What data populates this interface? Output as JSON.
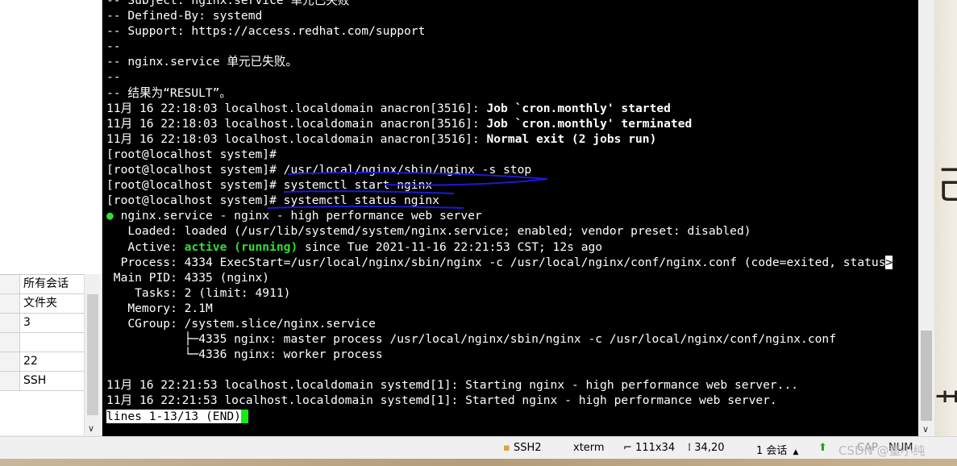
{
  "left_panel": {
    "properties": [
      "所有会话",
      "文件夹",
      "3",
      "",
      "22",
      "SSH"
    ]
  },
  "terminal": {
    "lines": [
      {
        "segments": [
          {
            "t": "-- Subject: nginx.service 单元已失败"
          }
        ]
      },
      {
        "segments": [
          {
            "t": "-- Defined-By: systemd"
          }
        ]
      },
      {
        "segments": [
          {
            "t": "-- Support: https://access.redhat.com/support"
          }
        ]
      },
      {
        "segments": [
          {
            "t": "--"
          }
        ]
      },
      {
        "segments": [
          {
            "t": "-- nginx.service 单元已失败。"
          }
        ]
      },
      {
        "segments": [
          {
            "t": "--"
          }
        ]
      },
      {
        "segments": [
          {
            "t": "-- 结果为“RESULT”。"
          }
        ]
      },
      {
        "segments": [
          {
            "t": "11月 16 22:18:03 localhost.localdomain anacron[3516]: "
          },
          {
            "t": "Job `cron.monthly' started",
            "s": "b"
          }
        ]
      },
      {
        "segments": [
          {
            "t": "11月 16 22:18:03 localhost.localdomain anacron[3516]: "
          },
          {
            "t": "Job `cron.monthly' terminated",
            "s": "b"
          }
        ]
      },
      {
        "segments": [
          {
            "t": "11月 16 22:18:03 localhost.localdomain anacron[3516]: "
          },
          {
            "t": "Normal exit (2 jobs run)",
            "s": "b"
          }
        ]
      },
      {
        "segments": [
          {
            "t": "[root@localhost system]#"
          }
        ]
      },
      {
        "segments": [
          {
            "t": "[root@localhost system]# /usr/local/nginx/sbin/nginx -s stop"
          }
        ]
      },
      {
        "segments": [
          {
            "t": "[root@localhost system]# systemctl start nginx"
          }
        ]
      },
      {
        "segments": [
          {
            "t": "[root@localhost system]# systemctl status nginx"
          }
        ]
      },
      {
        "segments": [
          {
            "t": "●",
            "s": "gd"
          },
          {
            "t": " nginx.service - nginx - high performance web server"
          }
        ]
      },
      {
        "segments": [
          {
            "t": "   Loaded: loaded (/usr/lib/systemd/system/nginx.service; enabled; vendor preset: disabled)"
          }
        ]
      },
      {
        "segments": [
          {
            "t": "   Active: "
          },
          {
            "t": "active (running)",
            "s": "g"
          },
          {
            "t": " since Tue 2021-11-16 22:21:53 CST; 12s ago"
          }
        ]
      },
      {
        "segments": [
          {
            "t": "  Process: 4334 ExecStart=/usr/local/nginx/sbin/nginx -c /usr/local/nginx/conf/nginx.conf (code=exited, status"
          },
          {
            "t": ">",
            "s": "cut"
          }
        ]
      },
      {
        "segments": [
          {
            "t": " Main PID: 4335 (nginx)"
          }
        ]
      },
      {
        "segments": [
          {
            "t": "    Tasks: 2 (limit: 4911)"
          }
        ]
      },
      {
        "segments": [
          {
            "t": "   Memory: 2.1M"
          }
        ]
      },
      {
        "segments": [
          {
            "t": "   CGroup: /system.slice/nginx.service"
          }
        ]
      },
      {
        "segments": [
          {
            "t": "           ├─4335 nginx: master process /usr/local/nginx/sbin/nginx -c /usr/local/nginx/conf/nginx.conf"
          }
        ]
      },
      {
        "segments": [
          {
            "t": "           └─4336 nginx: worker process"
          }
        ]
      },
      {
        "segments": [
          {
            "t": ""
          }
        ]
      },
      {
        "segments": [
          {
            "t": "11月 16 22:21:53 localhost.localdomain systemd[1]: Starting nginx - high performance web server..."
          }
        ]
      },
      {
        "segments": [
          {
            "t": "11月 16 22:21:53 localhost.localdomain systemd[1]: Started nginx - high performance web server."
          }
        ]
      },
      {
        "segments": [
          {
            "t": "lines 1-13/13 (END)",
            "s": "pager"
          },
          {
            "t": "",
            "s": "cursor"
          }
        ]
      }
    ]
  },
  "status_bar": {
    "protocol": "SSH2",
    "terminal_type": "xterm",
    "size": "111x34",
    "cursor_pos": "34,20",
    "sessions": "1 会话",
    "caps": "CAP",
    "num": "NUM"
  },
  "watermark": "CSDN @董小纯",
  "colors": {
    "terminal_bg": "#000000",
    "terminal_fg": "#ffffff",
    "active_green": "#33dd33",
    "cursor_green": "#11ee11",
    "annotation_blue": "#1a1ad6"
  }
}
